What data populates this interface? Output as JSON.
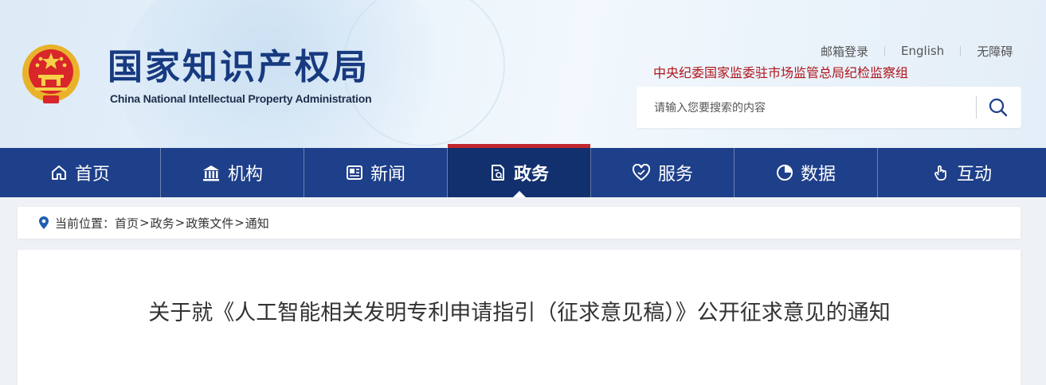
{
  "site": {
    "title": "国家知识产权局",
    "subtitle": "China National Intellectual Property Administration"
  },
  "topnav": {
    "mail": "邮箱登录",
    "english": "English",
    "accessibility": "无障碍"
  },
  "inspection_link": "中央纪委国家监委驻市场监管总局纪检监察组",
  "search": {
    "placeholder": "请输入您要搜索的内容"
  },
  "nav": [
    {
      "label": "首页",
      "icon": "home-icon"
    },
    {
      "label": "机构",
      "icon": "institution-icon"
    },
    {
      "label": "新闻",
      "icon": "news-icon"
    },
    {
      "label": "政务",
      "icon": "government-affairs-icon",
      "active": true
    },
    {
      "label": "服务",
      "icon": "service-heart-icon"
    },
    {
      "label": "数据",
      "icon": "pie-chart-icon"
    },
    {
      "label": "互动",
      "icon": "hand-pointer-icon"
    }
  ],
  "breadcrumb": {
    "prefix": "当前位置：",
    "items": [
      "首页",
      "政务",
      "政策文件",
      "通知"
    ]
  },
  "article": {
    "title": "关于就《人工智能相关发明专利申请指引（征求意见稿）》公开征求意见的通知"
  },
  "colors": {
    "nav_bg": "#1e3f89",
    "nav_active_bg": "#12306e",
    "accent_red": "#c2272d",
    "title_blue": "#173a80"
  }
}
